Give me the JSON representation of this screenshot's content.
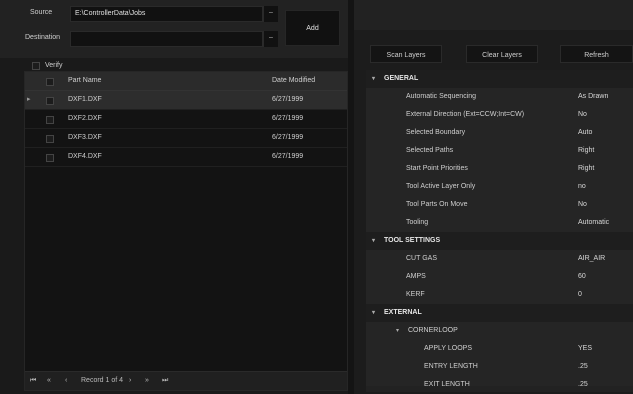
{
  "source": {
    "label": "Source",
    "value": "E:\\ControllerData\\Jobs",
    "dropdown": "–"
  },
  "destination": {
    "label": "Destination",
    "value": "",
    "dropdown": "–"
  },
  "add_button": "Add",
  "verify_label": "Verify",
  "grid": {
    "headers": {
      "part_name": "Part Name",
      "date_modified": "Date Modified"
    },
    "rows": [
      {
        "name": "DXF1.DXF",
        "date": "6/27/1999"
      },
      {
        "name": "DXF2.DXF",
        "date": "6/27/1999"
      },
      {
        "name": "DXF3.DXF",
        "date": "6/27/1999"
      },
      {
        "name": "DXF4.DXF",
        "date": "6/27/1999"
      }
    ],
    "pager": {
      "record_text": "Record 1 of 4"
    }
  },
  "right_buttons": {
    "scan": "Scan Layers",
    "clear": "Clear Layers",
    "refresh": "Refresh"
  },
  "properties": {
    "general": {
      "title": "GENERAL",
      "items": [
        {
          "name": "Automatic Sequencing",
          "value": "As Drawn"
        },
        {
          "name": "External Direction (Ext=CCW;Int=CW)",
          "value": "No"
        },
        {
          "name": "Selected Boundary",
          "value": "Auto"
        },
        {
          "name": "Selected Paths",
          "value": "Right"
        },
        {
          "name": "Start Point Priorities",
          "value": "Right"
        },
        {
          "name": "Tool Active Layer Only",
          "value": "no"
        },
        {
          "name": "Tool Parts On Move",
          "value": "No"
        },
        {
          "name": "Tooling",
          "value": "Automatic"
        }
      ]
    },
    "tool_settings": {
      "title": "TOOL SETTINGS",
      "items": [
        {
          "name": "CUT GAS",
          "value": "AIR_AIR"
        },
        {
          "name": "AMPS",
          "value": "60"
        },
        {
          "name": "KERF",
          "value": "0"
        }
      ]
    },
    "external": {
      "title": "EXTERNAL",
      "cornerloop": {
        "title": "CORNERLOOP",
        "items": [
          {
            "name": "APPLY LOOPS",
            "value": "YES"
          },
          {
            "name": "ENTRY LENGTH",
            "value": ".25"
          },
          {
            "name": "EXIT LENGTH",
            "value": ".25"
          }
        ]
      }
    }
  },
  "icons": {
    "expand": "▾",
    "row_pointer": "▸",
    "pager_first": "⏮",
    "pager_prev_page": "«",
    "pager_prev": "‹",
    "pager_next": "›",
    "pager_next_page": "»",
    "pager_last": "⏭"
  }
}
